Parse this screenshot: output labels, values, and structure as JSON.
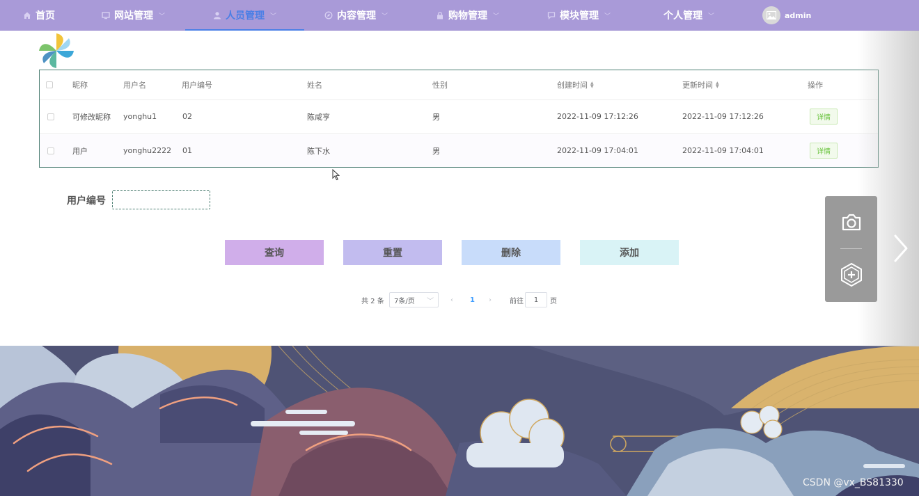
{
  "nav": {
    "items": [
      {
        "label": "首页",
        "has_menu": false,
        "active": false,
        "icon": "home-icon"
      },
      {
        "label": "网站管理",
        "has_menu": true,
        "active": false,
        "icon": "monitor-icon"
      },
      {
        "label": "人员管理",
        "has_menu": true,
        "active": true,
        "icon": "user-icon"
      },
      {
        "label": "内容管理",
        "has_menu": true,
        "active": false,
        "icon": "compass-icon"
      },
      {
        "label": "购物管理",
        "has_menu": true,
        "active": false,
        "icon": "lock-icon"
      },
      {
        "label": "模块管理",
        "has_menu": true,
        "active": false,
        "icon": "chat-icon"
      },
      {
        "label": "个人管理",
        "has_menu": true,
        "active": false,
        "icon": "none"
      }
    ],
    "user": "admin",
    "colors": {
      "bar": "#a99ad8",
      "active": "#4a7fe6"
    }
  },
  "table": {
    "columns": [
      "昵称",
      "用户名",
      "用户编号",
      "姓名",
      "性别",
      "创建时间",
      "更新时间",
      "操作"
    ],
    "sortable_columns": [
      "创建时间",
      "更新时间"
    ],
    "rows": [
      {
        "nickname": "可修改昵称",
        "username": "yonghu1",
        "user_no": "02",
        "name": "陈咸亨",
        "gender": "男",
        "created": "2022-11-09 17:12:26",
        "updated": "2022-11-09 17:12:26",
        "action": "详情"
      },
      {
        "nickname": "用户",
        "username": "yonghu2222",
        "user_no": "01",
        "name": "陈下水",
        "gender": "男",
        "created": "2022-11-09 17:04:01",
        "updated": "2022-11-09 17:04:01",
        "action": "详情"
      }
    ]
  },
  "search": {
    "label": "用户编号",
    "value": "",
    "placeholder": ""
  },
  "buttons": {
    "query": "查询",
    "reset": "重置",
    "delete": "删除",
    "add": "添加"
  },
  "pagination": {
    "total": "共 2 条",
    "page_size": "7条/页",
    "current_page": "1",
    "goto_prefix": "前往",
    "goto_value": "1",
    "goto_suffix": "页"
  },
  "watermark": "CSDN @vx_BS81330"
}
